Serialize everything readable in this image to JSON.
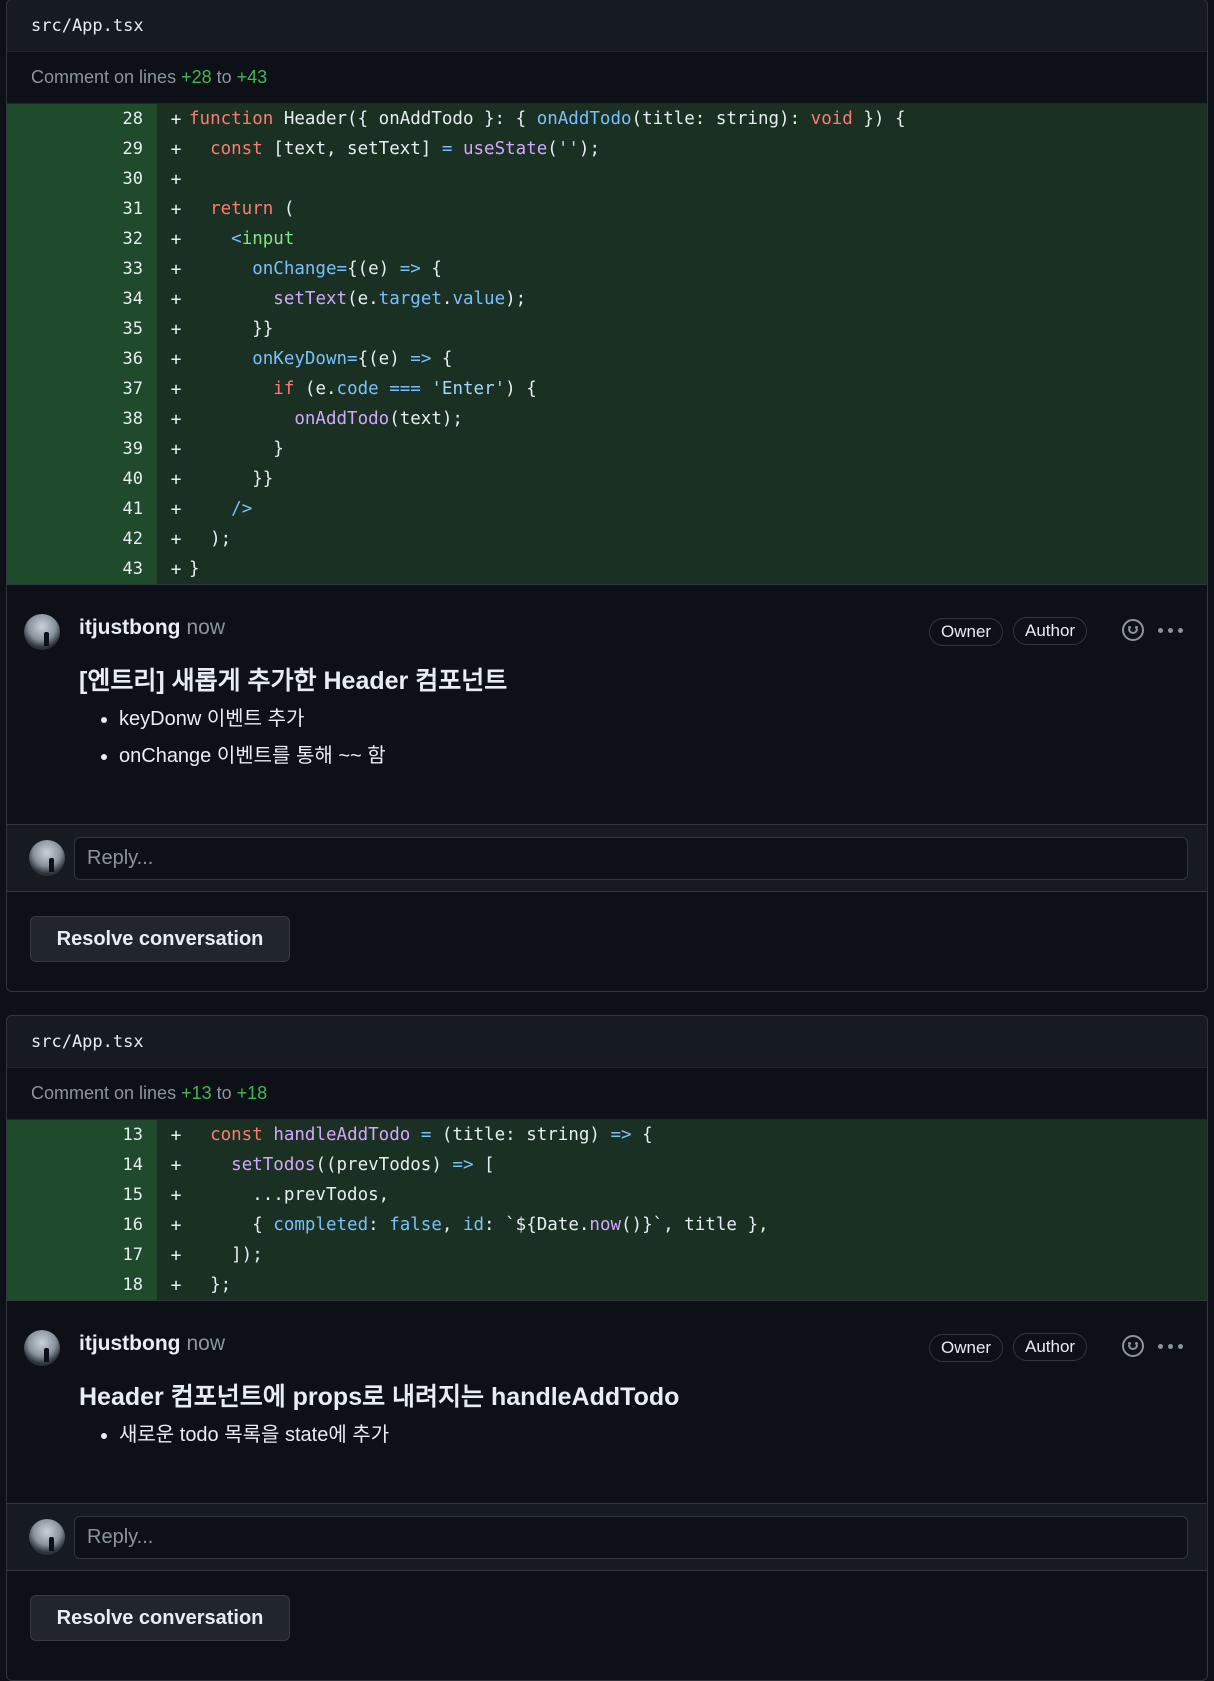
{
  "threads": [
    {
      "file_name": "src/App.tsx",
      "comment_on_prefix": "Comment on lines ",
      "line_start": "+28",
      "line_to": " to ",
      "line_end": "+43",
      "code_lines": [
        {
          "num": "28",
          "sign": "+",
          "tokens": [
            {
              "t": "function",
              "c": "kw"
            },
            {
              "t": " Header({ onAddTodo }: { "
            },
            {
              "t": "onAddTodo",
              "c": "prop"
            },
            {
              "t": "(title: string): "
            },
            {
              "t": "void",
              "c": "kw"
            },
            {
              "t": " }) {"
            }
          ]
        },
        {
          "num": "29",
          "sign": "+",
          "tokens": [
            {
              "t": "  "
            },
            {
              "t": "const",
              "c": "kw"
            },
            {
              "t": " [text, setText] "
            },
            {
              "t": "=",
              "c": "op"
            },
            {
              "t": " "
            },
            {
              "t": "useState",
              "c": "fn"
            },
            {
              "t": "("
            },
            {
              "t": "''",
              "c": "str"
            },
            {
              "t": ");"
            }
          ]
        },
        {
          "num": "30",
          "sign": "+",
          "tokens": []
        },
        {
          "num": "31",
          "sign": "+",
          "tokens": [
            {
              "t": "  "
            },
            {
              "t": "return",
              "c": "kw"
            },
            {
              "t": " ("
            }
          ]
        },
        {
          "num": "32",
          "sign": "+",
          "tokens": [
            {
              "t": "    "
            },
            {
              "t": "<",
              "c": "op"
            },
            {
              "t": "input",
              "c": "tag"
            }
          ]
        },
        {
          "num": "33",
          "sign": "+",
          "tokens": [
            {
              "t": "      "
            },
            {
              "t": "onChange",
              "c": "prop"
            },
            {
              "t": "=",
              "c": "op"
            },
            {
              "t": "{(e) "
            },
            {
              "t": "=>",
              "c": "op"
            },
            {
              "t": " {"
            }
          ]
        },
        {
          "num": "34",
          "sign": "+",
          "tokens": [
            {
              "t": "        "
            },
            {
              "t": "setText",
              "c": "fn"
            },
            {
              "t": "(e."
            },
            {
              "t": "target",
              "c": "prop"
            },
            {
              "t": "."
            },
            {
              "t": "value",
              "c": "prop"
            },
            {
              "t": ");"
            }
          ]
        },
        {
          "num": "35",
          "sign": "+",
          "tokens": [
            {
              "t": "      }}"
            }
          ]
        },
        {
          "num": "36",
          "sign": "+",
          "tokens": [
            {
              "t": "      "
            },
            {
              "t": "onKeyDown",
              "c": "prop"
            },
            {
              "t": "=",
              "c": "op"
            },
            {
              "t": "{(e) "
            },
            {
              "t": "=>",
              "c": "op"
            },
            {
              "t": " {"
            }
          ]
        },
        {
          "num": "37",
          "sign": "+",
          "tokens": [
            {
              "t": "        "
            },
            {
              "t": "if",
              "c": "kw"
            },
            {
              "t": " (e."
            },
            {
              "t": "code",
              "c": "prop"
            },
            {
              "t": " "
            },
            {
              "t": "===",
              "c": "op"
            },
            {
              "t": " "
            },
            {
              "t": "'Enter'",
              "c": "str"
            },
            {
              "t": ") {"
            }
          ]
        },
        {
          "num": "38",
          "sign": "+",
          "tokens": [
            {
              "t": "          "
            },
            {
              "t": "onAddTodo",
              "c": "fn"
            },
            {
              "t": "(text);"
            }
          ]
        },
        {
          "num": "39",
          "sign": "+",
          "tokens": [
            {
              "t": "        }"
            }
          ]
        },
        {
          "num": "40",
          "sign": "+",
          "tokens": [
            {
              "t": "      }}"
            }
          ]
        },
        {
          "num": "41",
          "sign": "+",
          "tokens": [
            {
              "t": "    "
            },
            {
              "t": "/>",
              "c": "op"
            }
          ]
        },
        {
          "num": "42",
          "sign": "+",
          "tokens": [
            {
              "t": "  );"
            }
          ]
        },
        {
          "num": "43",
          "sign": "+",
          "tokens": [
            {
              "t": "}"
            }
          ]
        }
      ],
      "comment": {
        "author": "itjustbong",
        "time": "now",
        "badges": [
          "Owner",
          "Author"
        ],
        "title": "[엔트리] 새롭게 추가한 Header 컴포넌트",
        "bullets": [
          "keyDonw 이벤트 추가",
          "onChange 이벤트를 통해 ~~ 함"
        ]
      },
      "reply_placeholder": "Reply...",
      "resolve_label": "Resolve conversation"
    },
    {
      "file_name": "src/App.tsx",
      "comment_on_prefix": "Comment on lines ",
      "line_start": "+13",
      "line_to": " to ",
      "line_end": "+18",
      "code_lines": [
        {
          "num": "13",
          "sign": "+",
          "tokens": [
            {
              "t": "  "
            },
            {
              "t": "const",
              "c": "kw"
            },
            {
              "t": " "
            },
            {
              "t": "handleAddTodo",
              "c": "fn"
            },
            {
              "t": " "
            },
            {
              "t": "=",
              "c": "op"
            },
            {
              "t": " (title: string) "
            },
            {
              "t": "=>",
              "c": "op"
            },
            {
              "t": " {"
            }
          ]
        },
        {
          "num": "14",
          "sign": "+",
          "tokens": [
            {
              "t": "    "
            },
            {
              "t": "setTodos",
              "c": "fn"
            },
            {
              "t": "((prevTodos) "
            },
            {
              "t": "=>",
              "c": "op"
            },
            {
              "t": " ["
            }
          ]
        },
        {
          "num": "15",
          "sign": "+",
          "tokens": [
            {
              "t": "      ...prevTodos,"
            }
          ]
        },
        {
          "num": "16",
          "sign": "+",
          "tokens": [
            {
              "t": "      { "
            },
            {
              "t": "completed",
              "c": "prop"
            },
            {
              "t": ": "
            },
            {
              "t": "false",
              "c": "prop"
            },
            {
              "t": ", "
            },
            {
              "t": "id",
              "c": "prop"
            },
            {
              "t": ": `${Date."
            },
            {
              "t": "now",
              "c": "fn"
            },
            {
              "t": "()}`, title },"
            }
          ]
        },
        {
          "num": "17",
          "sign": "+",
          "tokens": [
            {
              "t": "    ]);"
            }
          ]
        },
        {
          "num": "18",
          "sign": "+",
          "tokens": [
            {
              "t": "  };"
            }
          ]
        }
      ],
      "comment": {
        "author": "itjustbong",
        "time": "now",
        "badges": [
          "Owner",
          "Author"
        ],
        "title": "Header 컴포넌트에 props로 내려지는 handleAddTodo",
        "bullets": [
          "새로운 todo 목록을 state에 추가"
        ]
      },
      "reply_placeholder": "Reply...",
      "resolve_label": "Resolve conversation"
    }
  ]
}
